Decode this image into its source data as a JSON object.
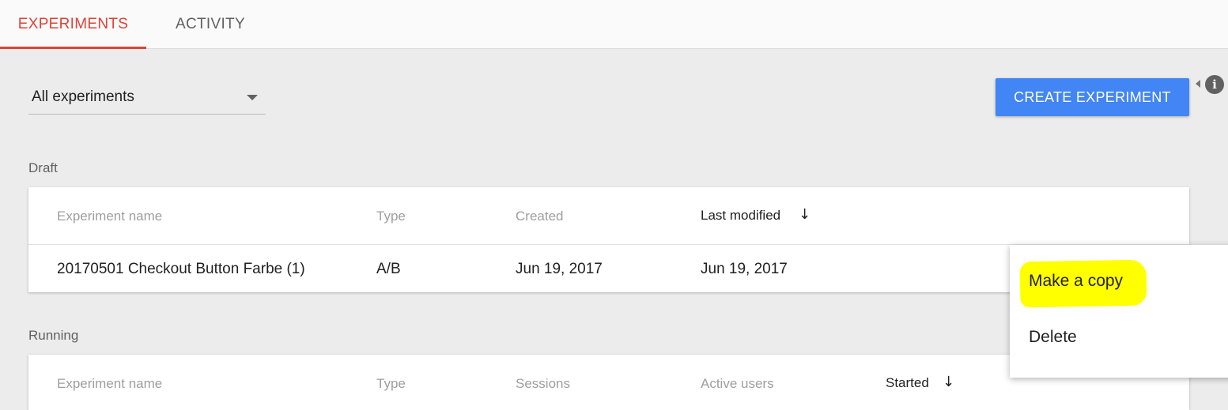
{
  "tabs": [
    {
      "label": "EXPERIMENTS",
      "active": true
    },
    {
      "label": "ACTIVITY",
      "active": false
    }
  ],
  "filter": {
    "selected": "All experiments"
  },
  "create_button": {
    "label": "CREATE EXPERIMENT"
  },
  "info_icon": {
    "glyph": "i"
  },
  "draft": {
    "title": "Draft",
    "columns": [
      "Experiment name",
      "Type",
      "Created",
      "Last modified"
    ],
    "sorted_column": "Last modified",
    "sort_glyph": "↓",
    "rows": [
      {
        "name": "20170501 Checkout Button Farbe (1)",
        "type": "A/B",
        "created": "Jun 19, 2017",
        "last_modified": "Jun 19, 2017"
      }
    ]
  },
  "running": {
    "title": "Running",
    "columns": [
      "Experiment name",
      "Type",
      "Sessions",
      "Active users",
      "Started"
    ],
    "sorted_column": "Started",
    "sort_glyph": "↓"
  },
  "context_menu": {
    "items": [
      "Make a copy",
      "Delete"
    ],
    "highlighted_item": "Make a copy",
    "highlight_color": "#ffff00"
  },
  "colors": {
    "accent": "#db4437",
    "primary_button": "#4285f4",
    "background": "#ececec"
  }
}
